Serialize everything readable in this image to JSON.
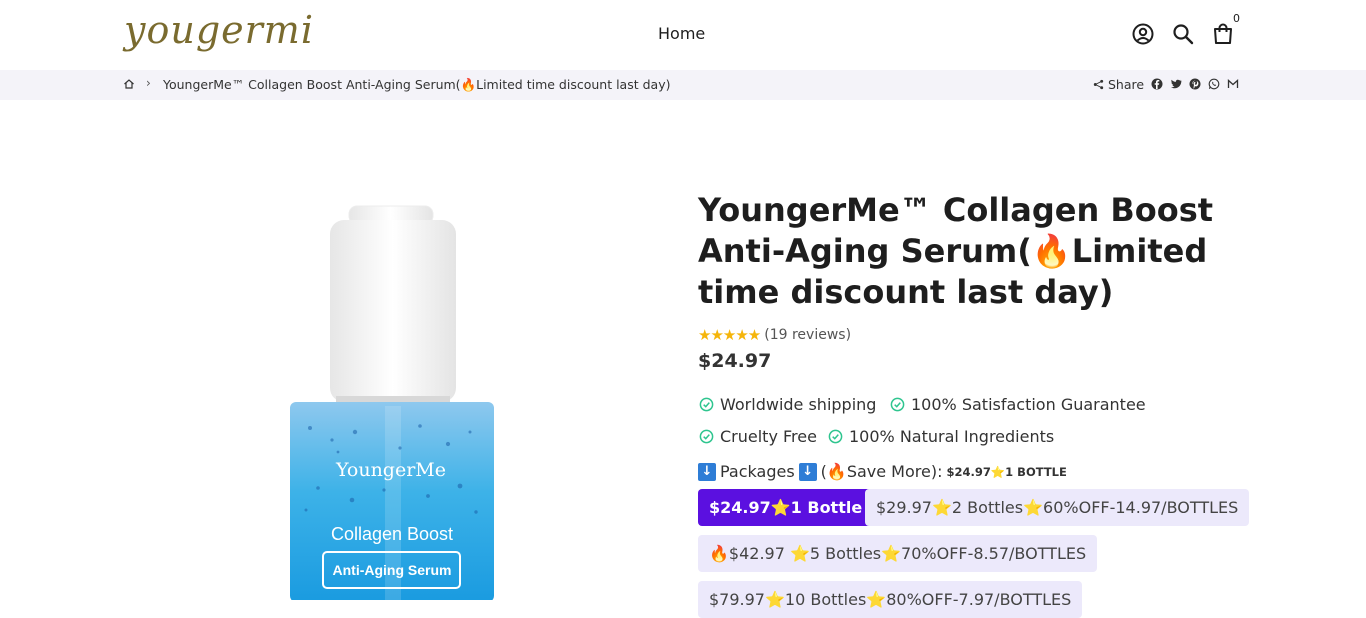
{
  "header": {
    "logo_text": "yougermi",
    "nav_home": "Home",
    "cart_count": "0",
    "icons": [
      "account-icon",
      "search-icon",
      "cart-icon"
    ]
  },
  "breadcrumb": {
    "current": "YoungerMe™ Collagen Boost Anti-Aging Serum(🔥Limited time discount last day)",
    "share_label": "Share",
    "share_icons": [
      "facebook-icon",
      "twitter-icon",
      "pinterest-icon",
      "whatsapp-icon",
      "email-icon"
    ]
  },
  "product": {
    "image_texts": {
      "brand": "YoungerMe",
      "line": "Collagen Boost",
      "sub": "Anti-Aging Serum"
    },
    "title": "YoungerMe™ Collagen Boost Anti-Aging Serum(🔥Limited time discount last day)",
    "reviews_text": "(19 reviews)",
    "rating_stars": 5,
    "price": "$24.97",
    "features": [
      "Worldwide shipping",
      "100% Satisfaction Guarantee",
      "Cruelty Free",
      "100% Natural Ingredients"
    ],
    "packages_label": "Packages",
    "packages_label_suffix": "(🔥Save More):",
    "packages_selected": "$24.97⭐1 BOTTLE",
    "options": [
      "$24.97⭐1 Bottle",
      "$29.97⭐2 Bottles⭐60%OFF-14.97/BOTTLES",
      "🔥$42.97 ⭐5 Bottles⭐70%OFF-8.57/BOTTLES",
      "$79.97⭐10 Bottles⭐80%OFF-7.97/BOTTLES"
    ]
  },
  "colors": {
    "accent": "#5b10e0",
    "option_bg": "#ece9fb",
    "check_green": "#2fc58f",
    "star": "#f5b50a",
    "logo": "#7a6b2f"
  }
}
